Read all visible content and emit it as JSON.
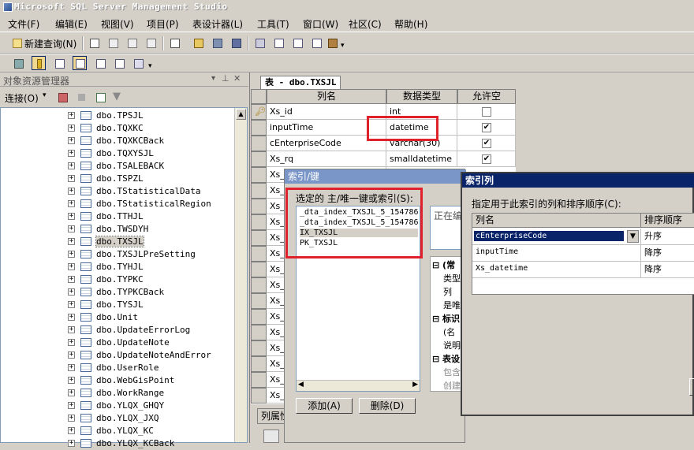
{
  "window": {
    "title": "Microsoft SQL Server Management Studio"
  },
  "menu": [
    "文件(F)",
    "编辑(E)",
    "视图(V)",
    "项目(P)",
    "表设计器(L)",
    "工具(T)",
    "窗口(W)",
    "社区(C)",
    "帮助(H)"
  ],
  "toolbar": {
    "new_query": "新建查询(N)"
  },
  "object_explorer": {
    "title": "对象资源管理器",
    "connect": "连接(O)",
    "items": [
      "dbo.TPSJL",
      "dbo.TQXKC",
      "dbo.TQXKCBack",
      "dbo.TQXYSJL",
      "dbo.TSALEBACK",
      "dbo.TSPZL",
      "dbo.TStatisticalData",
      "dbo.TStatisticalRegion",
      "dbo.TTHJL",
      "dbo.TWSDYH",
      "dbo.TXSJL",
      "dbo.TXSJLPreSetting",
      "dbo.TYHJL",
      "dbo.TYPKC",
      "dbo.TYPKCBack",
      "dbo.TYSJL",
      "dbo.Unit",
      "dbo.UpdateErrorLog",
      "dbo.UpdateNote",
      "dbo.UpdateNoteAndError",
      "dbo.UserRole",
      "dbo.WebGisPoint",
      "dbo.WorkRange",
      "dbo.YLQX_GHQY",
      "dbo.YLQX_JXQ",
      "dbo.YLQX_KC",
      "dbo.YLQX_KCBack"
    ],
    "selected": "dbo.TXSJL"
  },
  "tab": {
    "label": "表 - dbo.TXSJL"
  },
  "grid": {
    "headers": [
      "列名",
      "数据类型",
      "允许空"
    ],
    "rows": [
      {
        "name": "Xs_id",
        "type": "int",
        "nullable": false
      },
      {
        "name": "inputTime",
        "type": "datetime",
        "nullable": true
      },
      {
        "name": "cEnterpriseCode",
        "type": "varchar(30)",
        "nullable": true
      },
      {
        "name": "Xs_rq",
        "type": "smalldatetime",
        "nullable": true
      }
    ],
    "partial_rows": [
      "Xs_",
      "Xs_",
      "Xs_",
      "Xs_",
      "Xs_",
      "Xs_",
      "Xs_",
      "Xs_",
      "Xs_",
      "Xs_",
      "Xs_",
      "Xs_",
      "Xs_",
      "Xs_",
      "Xs_"
    ]
  },
  "column_props_tab": "列属性",
  "index_dialog": {
    "title": "索引/键",
    "list_label": "选定的 主/唯一键或索引(S):",
    "items": [
      "_dta_index_TXSJL_5_154786",
      "_dta_index_TXSJL_5_154786",
      "IX_TXSJL",
      "PK_TXSJL"
    ],
    "selected": "IX_TXSJL",
    "editing": "正在编",
    "props": [
      "(常",
      "类型",
      "列",
      "是唯",
      "标识",
      "(名",
      "说明",
      "表设",
      "包含",
      "创建"
    ],
    "add": "添加(A)",
    "delete": "删除(D)"
  },
  "index_columns": {
    "title": "索引列",
    "label": "指定用于此索引的列和排序顺序(C):",
    "headers": [
      "列名",
      "排序顺序"
    ],
    "rows": [
      {
        "name": "cEnterpriseCode",
        "order": "升序"
      },
      {
        "name": "inputTime",
        "order": "降序"
      },
      {
        "name": "Xs_datetime",
        "order": "降序"
      }
    ]
  },
  "colors": {
    "highlight": "#e0202a",
    "title_blue": "#0a246a",
    "selection": "#0a246a"
  }
}
